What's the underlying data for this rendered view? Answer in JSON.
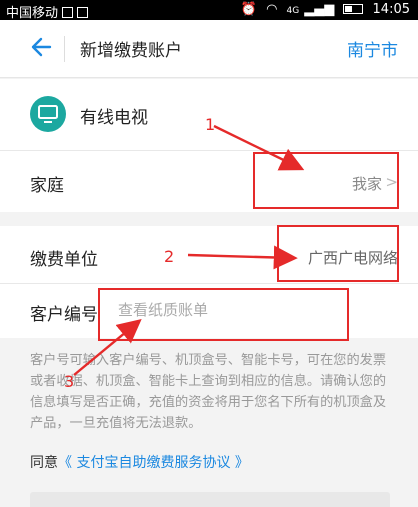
{
  "status_bar": {
    "carrier": "中国移动",
    "time": "14:05",
    "signal_text": "4G"
  },
  "nav": {
    "title": "新增缴费账户",
    "city": "南宁市"
  },
  "service": {
    "label": "有线电视"
  },
  "household": {
    "label": "家庭",
    "value": "我家",
    "chevron": ">"
  },
  "billing_unit": {
    "label": "缴费单位",
    "value": "广西广电网络"
  },
  "customer_number": {
    "label": "客户编号",
    "placeholder": "查看纸质账单"
  },
  "notice": "客户号可输入客户编号、机顶盒号、智能卡号，可在您的发票或者收据、机顶盒、智能卡上查询到相应的信息。请确认您的信息填写是否正确，充值的资金将用于您名下所有的机顶盒及产品，一旦充值将无法退款。",
  "agreement": {
    "prefix": "同意",
    "link": "《 支付宝自助缴费服务协议 》"
  },
  "annotations": {
    "num1": "1",
    "num2": "2",
    "num3": "3",
    "color": "#e52a2a"
  },
  "colors": {
    "accent": "#1b88e0",
    "tv_icon": "#1ca8a0"
  }
}
